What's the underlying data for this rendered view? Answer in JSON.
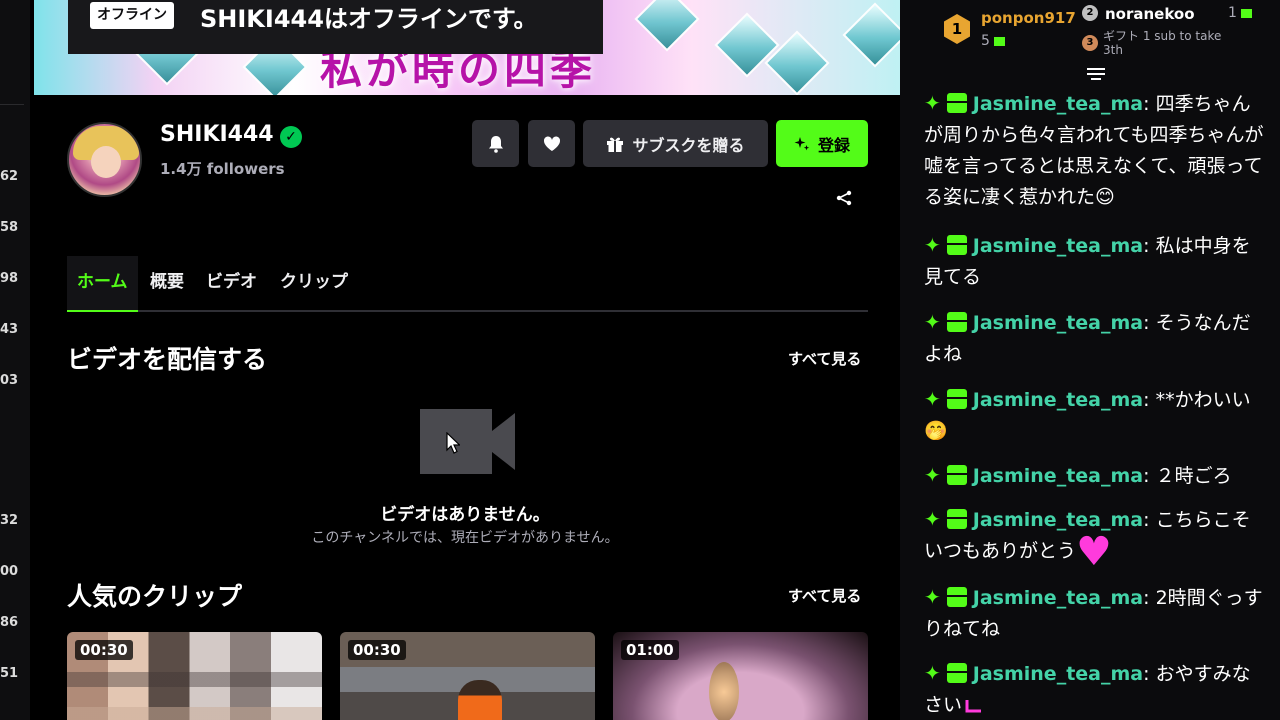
{
  "left_sidebar": {
    "numbers": [
      "62",
      "58",
      "98",
      "43",
      "03",
      "32",
      "00",
      "86",
      "51"
    ]
  },
  "banner": {
    "title_text": "私が時の四季",
    "offline_badge": "オフライン",
    "offline_message": "SHIKI444はオフラインです。"
  },
  "channel": {
    "name": "SHIKI444",
    "followers": "1.4万 followers",
    "verified_icon": "check-icon"
  },
  "actions": {
    "gift_label": "サブスクを贈る",
    "subscribe_label": "登録"
  },
  "tabs": [
    {
      "label": "ホーム",
      "active": true
    },
    {
      "label": "概要",
      "active": false
    },
    {
      "label": "ビデオ",
      "active": false
    },
    {
      "label": "クリップ",
      "active": false
    }
  ],
  "videos_section": {
    "title": "ビデオを配信する",
    "see_all": "すべて見る",
    "empty_title": "ビデオはありません。",
    "empty_subtitle": "このチャンネルでは、現在ビデオがありません。"
  },
  "clips_section": {
    "title": "人気のクリップ",
    "see_all": "すべて見る",
    "clips": [
      {
        "duration": "00:30"
      },
      {
        "duration": "00:30"
      },
      {
        "duration": "01:00"
      }
    ]
  },
  "leaderboard": {
    "first": {
      "rank": "1",
      "name": "ponpon917",
      "count": "5"
    },
    "second": {
      "rank": "2",
      "name": "noranekoo",
      "count": "1"
    },
    "third": {
      "rank": "3",
      "text": "ギフト 1 sub to take 3th"
    }
  },
  "chat": {
    "messages": [
      {
        "user": "Jasmine_tea_ma",
        "text": "四季ちゃんが周りから色々言われても四季ちゃんが嘘を言ってるとは思えなくて、頑張ってる姿に凄く惹かれた",
        "emoji": "😊"
      },
      {
        "user": "Jasmine_tea_ma",
        "text": "私は中身を見てる",
        "emoji": ""
      },
      {
        "user": "Jasmine_tea_ma",
        "text": "そうなんだよね",
        "emoji": ""
      },
      {
        "user": "Jasmine_tea_ma",
        "text": "**かわいい",
        "emoji": "🤭"
      },
      {
        "user": "Jasmine_tea_ma",
        "text": "２時ごろ",
        "emoji": ""
      },
      {
        "user": "Jasmine_tea_ma",
        "text": "こちらこそ いつもありがとう",
        "emoji": "♥"
      },
      {
        "user": "Jasmine_tea_ma",
        "text": "2時間ぐっすりねてね",
        "emoji": ""
      },
      {
        "user": "Jasmine_tea_ma",
        "text": "おやすみなさい",
        "emoji": ""
      }
    ]
  },
  "colors": {
    "accent": "#53fc18",
    "username": "#44d3a8",
    "banner_text": "#b613a8"
  }
}
